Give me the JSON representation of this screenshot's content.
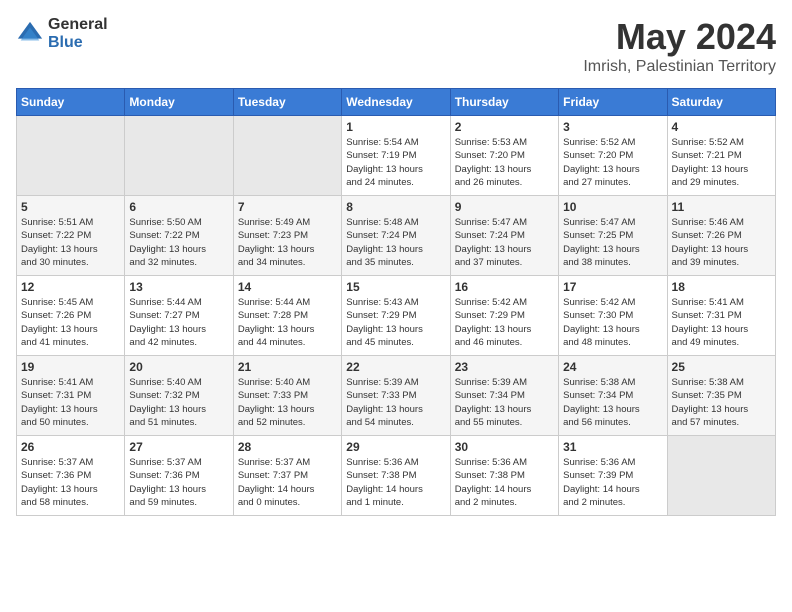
{
  "logo": {
    "general": "General",
    "blue": "Blue"
  },
  "title": {
    "month_year": "May 2024",
    "location": "Imrish, Palestinian Territory"
  },
  "days_of_week": [
    "Sunday",
    "Monday",
    "Tuesday",
    "Wednesday",
    "Thursday",
    "Friday",
    "Saturday"
  ],
  "weeks": [
    [
      {
        "day": "",
        "info": ""
      },
      {
        "day": "",
        "info": ""
      },
      {
        "day": "",
        "info": ""
      },
      {
        "day": "1",
        "info": "Sunrise: 5:54 AM\nSunset: 7:19 PM\nDaylight: 13 hours\nand 24 minutes."
      },
      {
        "day": "2",
        "info": "Sunrise: 5:53 AM\nSunset: 7:20 PM\nDaylight: 13 hours\nand 26 minutes."
      },
      {
        "day": "3",
        "info": "Sunrise: 5:52 AM\nSunset: 7:20 PM\nDaylight: 13 hours\nand 27 minutes."
      },
      {
        "day": "4",
        "info": "Sunrise: 5:52 AM\nSunset: 7:21 PM\nDaylight: 13 hours\nand 29 minutes."
      }
    ],
    [
      {
        "day": "5",
        "info": "Sunrise: 5:51 AM\nSunset: 7:22 PM\nDaylight: 13 hours\nand 30 minutes."
      },
      {
        "day": "6",
        "info": "Sunrise: 5:50 AM\nSunset: 7:22 PM\nDaylight: 13 hours\nand 32 minutes."
      },
      {
        "day": "7",
        "info": "Sunrise: 5:49 AM\nSunset: 7:23 PM\nDaylight: 13 hours\nand 34 minutes."
      },
      {
        "day": "8",
        "info": "Sunrise: 5:48 AM\nSunset: 7:24 PM\nDaylight: 13 hours\nand 35 minutes."
      },
      {
        "day": "9",
        "info": "Sunrise: 5:47 AM\nSunset: 7:24 PM\nDaylight: 13 hours\nand 37 minutes."
      },
      {
        "day": "10",
        "info": "Sunrise: 5:47 AM\nSunset: 7:25 PM\nDaylight: 13 hours\nand 38 minutes."
      },
      {
        "day": "11",
        "info": "Sunrise: 5:46 AM\nSunset: 7:26 PM\nDaylight: 13 hours\nand 39 minutes."
      }
    ],
    [
      {
        "day": "12",
        "info": "Sunrise: 5:45 AM\nSunset: 7:26 PM\nDaylight: 13 hours\nand 41 minutes."
      },
      {
        "day": "13",
        "info": "Sunrise: 5:44 AM\nSunset: 7:27 PM\nDaylight: 13 hours\nand 42 minutes."
      },
      {
        "day": "14",
        "info": "Sunrise: 5:44 AM\nSunset: 7:28 PM\nDaylight: 13 hours\nand 44 minutes."
      },
      {
        "day": "15",
        "info": "Sunrise: 5:43 AM\nSunset: 7:29 PM\nDaylight: 13 hours\nand 45 minutes."
      },
      {
        "day": "16",
        "info": "Sunrise: 5:42 AM\nSunset: 7:29 PM\nDaylight: 13 hours\nand 46 minutes."
      },
      {
        "day": "17",
        "info": "Sunrise: 5:42 AM\nSunset: 7:30 PM\nDaylight: 13 hours\nand 48 minutes."
      },
      {
        "day": "18",
        "info": "Sunrise: 5:41 AM\nSunset: 7:31 PM\nDaylight: 13 hours\nand 49 minutes."
      }
    ],
    [
      {
        "day": "19",
        "info": "Sunrise: 5:41 AM\nSunset: 7:31 PM\nDaylight: 13 hours\nand 50 minutes."
      },
      {
        "day": "20",
        "info": "Sunrise: 5:40 AM\nSunset: 7:32 PM\nDaylight: 13 hours\nand 51 minutes."
      },
      {
        "day": "21",
        "info": "Sunrise: 5:40 AM\nSunset: 7:33 PM\nDaylight: 13 hours\nand 52 minutes."
      },
      {
        "day": "22",
        "info": "Sunrise: 5:39 AM\nSunset: 7:33 PM\nDaylight: 13 hours\nand 54 minutes."
      },
      {
        "day": "23",
        "info": "Sunrise: 5:39 AM\nSunset: 7:34 PM\nDaylight: 13 hours\nand 55 minutes."
      },
      {
        "day": "24",
        "info": "Sunrise: 5:38 AM\nSunset: 7:34 PM\nDaylight: 13 hours\nand 56 minutes."
      },
      {
        "day": "25",
        "info": "Sunrise: 5:38 AM\nSunset: 7:35 PM\nDaylight: 13 hours\nand 57 minutes."
      }
    ],
    [
      {
        "day": "26",
        "info": "Sunrise: 5:37 AM\nSunset: 7:36 PM\nDaylight: 13 hours\nand 58 minutes."
      },
      {
        "day": "27",
        "info": "Sunrise: 5:37 AM\nSunset: 7:36 PM\nDaylight: 13 hours\nand 59 minutes."
      },
      {
        "day": "28",
        "info": "Sunrise: 5:37 AM\nSunset: 7:37 PM\nDaylight: 14 hours\nand 0 minutes."
      },
      {
        "day": "29",
        "info": "Sunrise: 5:36 AM\nSunset: 7:38 PM\nDaylight: 14 hours\nand 1 minute."
      },
      {
        "day": "30",
        "info": "Sunrise: 5:36 AM\nSunset: 7:38 PM\nDaylight: 14 hours\nand 2 minutes."
      },
      {
        "day": "31",
        "info": "Sunrise: 5:36 AM\nSunset: 7:39 PM\nDaylight: 14 hours\nand 2 minutes."
      },
      {
        "day": "",
        "info": ""
      }
    ]
  ]
}
